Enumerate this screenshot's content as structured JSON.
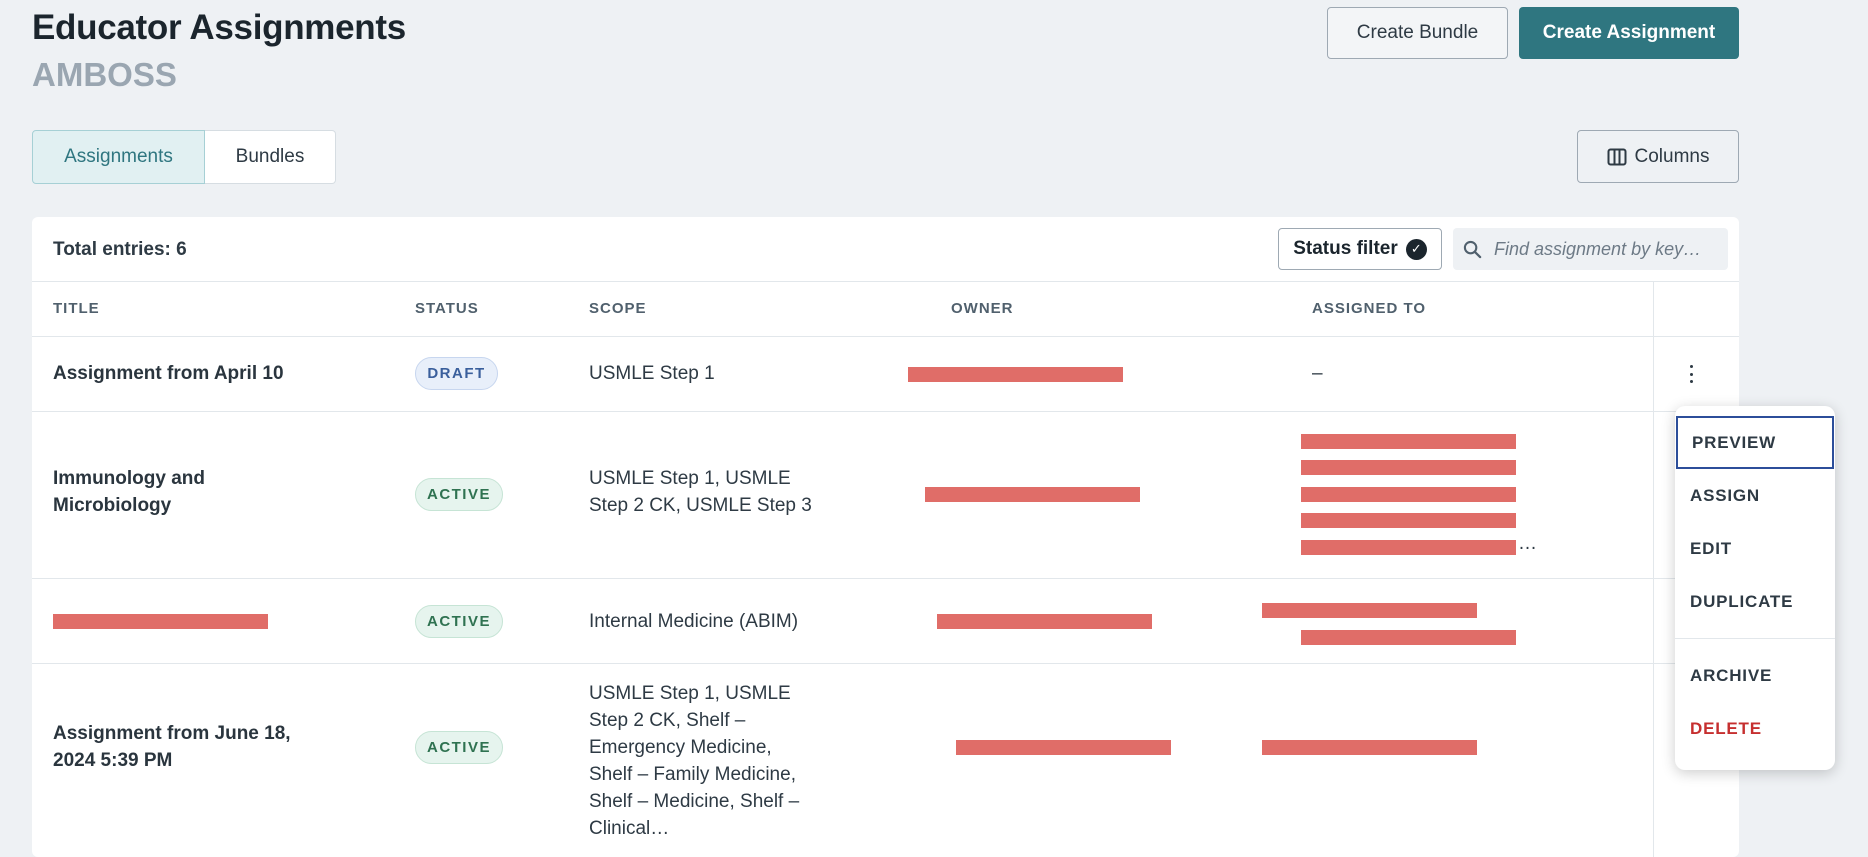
{
  "header": {
    "title": "Educator Assignments",
    "org": "AMBOSS",
    "create_bundle_label": "Create Bundle",
    "create_assignment_label": "Create Assignment"
  },
  "tabs": [
    {
      "label": "Assignments",
      "selected": true
    },
    {
      "label": "Bundles",
      "selected": false
    }
  ],
  "columns_button_label": "Columns",
  "table": {
    "total_entries": "Total entries: 6",
    "status_filter_label": "Status filter",
    "search_placeholder": "Find assignment by key…",
    "headers": [
      "TITLE",
      "STATUS",
      "SCOPE",
      "OWNER",
      "ASSIGNED TO"
    ],
    "rows": [
      {
        "title": "Assignment from April 10",
        "status": "DRAFT",
        "scope": "USMLE Step 1",
        "owner": "",
        "assigned_to": "–"
      },
      {
        "title": "Immunology and Microbiology",
        "status": "ACTIVE",
        "scope": "USMLE Step 1, USMLE Step 2 CK, USMLE Step 3",
        "owner": "",
        "assigned_to": "…"
      },
      {
        "title": "",
        "status": "ACTIVE",
        "scope": "Internal Medicine (ABIM)",
        "owner": "",
        "assigned_to": ""
      },
      {
        "title": "Assignment from June 18, 2024 5:39 PM",
        "status": "ACTIVE",
        "scope": "USMLE Step 1, USMLE Step 2 CK, Shelf – Emergency Medicine, Shelf – Family Medicine, Shelf – Medicine, Shelf – Clinical…",
        "owner": "",
        "assigned_to": ""
      }
    ]
  },
  "context_menu": {
    "items": [
      "PREVIEW",
      "ASSIGN",
      "EDIT",
      "DUPLICATE",
      "ARCHIVE",
      "DELETE"
    ]
  },
  "colors": {
    "primary": "#2f7680",
    "background": "#eef1f4",
    "danger": "#c62f2f",
    "redaction": "#e06d68"
  }
}
